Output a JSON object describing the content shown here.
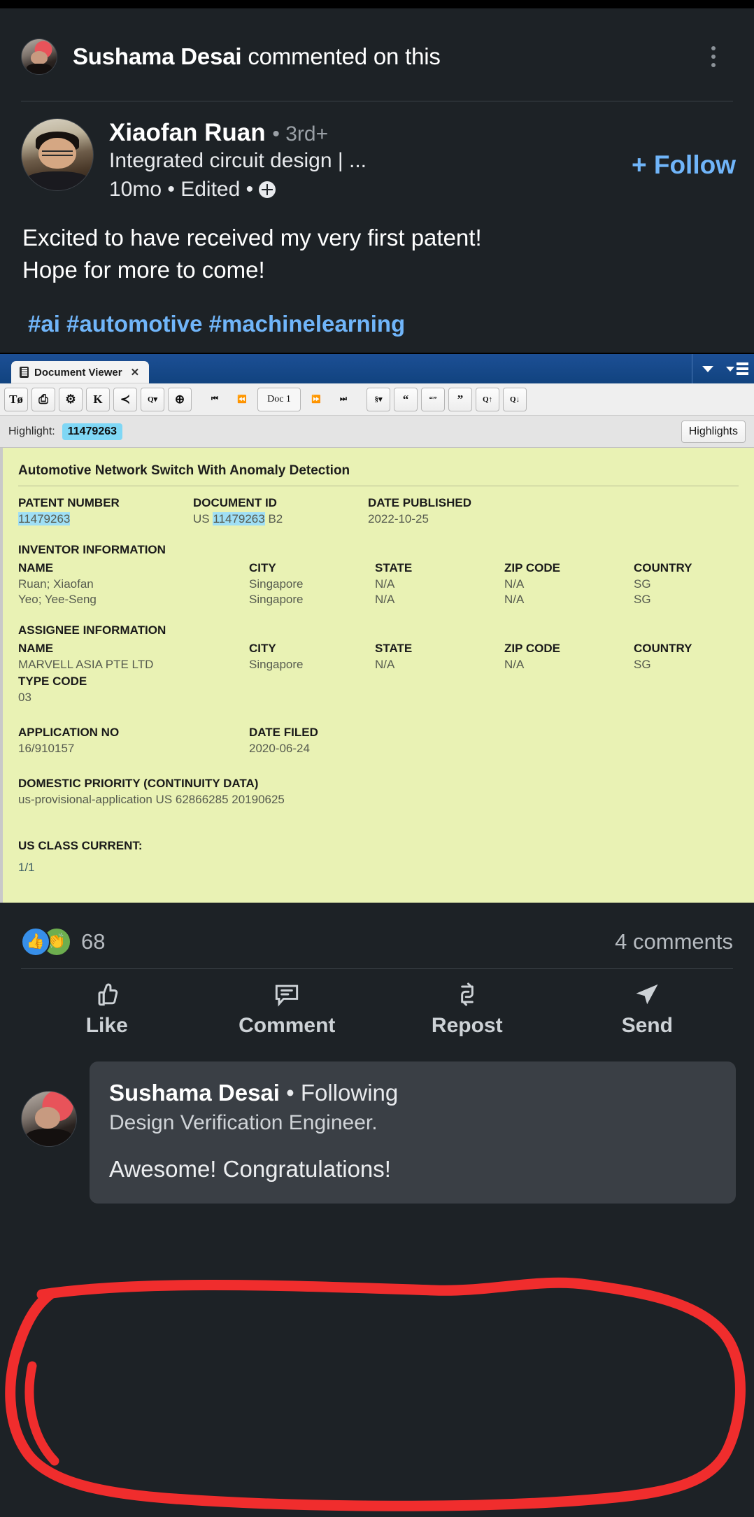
{
  "activity": {
    "actor": "Sushama Desai",
    "action": " commented on this",
    "menu_icon": "kebab-menu-icon"
  },
  "post": {
    "author_name": "Xiaofan Ruan",
    "author_degree": "• 3rd+",
    "headline": "Integrated circuit design | ...",
    "timestamp": "10mo • Edited •",
    "visibility_icon": "globe-icon",
    "follow_label": "+ Follow",
    "text_line1": "Excited to have received my very first patent!",
    "text_line2": "Hope for more to come!",
    "hashtags": "#ai #automotive #machinelearning"
  },
  "doc_viewer": {
    "tab_label": "Document Viewer",
    "tab_close": "✕",
    "toolbar": [
      {
        "name": "text-image-toggle-button",
        "glyph": "Tø"
      },
      {
        "name": "print-button",
        "glyph": "⎙"
      },
      {
        "name": "settings-gear-button",
        "glyph": "⚙"
      },
      {
        "name": "k-logo-button",
        "glyph": "K"
      },
      {
        "name": "share-button",
        "glyph": "≺"
      },
      {
        "name": "search-dropdown-button",
        "glyph": "Q▾"
      },
      {
        "name": "zoom-in-button",
        "glyph": "⊕"
      },
      {
        "name": "first-doc-button",
        "glyph": "⏮"
      },
      {
        "name": "prev-doc-button",
        "glyph": "⏪"
      },
      {
        "name": "doc-number-field",
        "glyph": "Doc 1"
      },
      {
        "name": "next-doc-button",
        "glyph": "⏩"
      },
      {
        "name": "last-doc-button",
        "glyph": "⏭"
      },
      {
        "name": "section-dropdown-button",
        "glyph": "§▾"
      },
      {
        "name": "quote-open-button",
        "glyph": "“"
      },
      {
        "name": "quote-both-button",
        "glyph": "“”"
      },
      {
        "name": "quote-close-button",
        "glyph": "”"
      },
      {
        "name": "search-prev-button",
        "glyph": "Q↑"
      },
      {
        "name": "search-next-button",
        "glyph": "Q↓"
      }
    ],
    "tabbar_dropdown_icon": "chevron-down-icon",
    "tabbar_list_icon": "list-menu-icon",
    "highlight_label": "Highlight:",
    "highlight_value": "11479263",
    "highlights_button": "Highlights"
  },
  "patent": {
    "title": "Automotive Network Switch With Anomaly Detection",
    "top_headers": [
      "PATENT NUMBER",
      "DOCUMENT ID",
      "DATE PUBLISHED"
    ],
    "patent_number": "11479263",
    "document_id_prefix": "US ",
    "document_id_mark": "11479263",
    "document_id_suffix": " B2",
    "date_published": "2022-10-25",
    "inventor_section": "INVENTOR INFORMATION",
    "person_headers": [
      "NAME",
      "CITY",
      "STATE",
      "ZIP CODE",
      "COUNTRY"
    ],
    "inventors": [
      [
        "Ruan; Xiaofan",
        "Singapore",
        "N/A",
        "N/A",
        "SG"
      ],
      [
        "Yeo; Yee-Seng",
        "Singapore",
        "N/A",
        "N/A",
        "SG"
      ]
    ],
    "assignee_section": "ASSIGNEE INFORMATION",
    "assignees": [
      [
        "MARVELL ASIA PTE LTD",
        "Singapore",
        "N/A",
        "N/A",
        "SG"
      ]
    ],
    "type_code_label": "TYPE CODE",
    "type_code_value": "03",
    "application_headers": [
      "APPLICATION NO",
      "DATE FILED"
    ],
    "application_no": "16/910157",
    "date_filed": "2020-06-24",
    "domestic_priority_label": "DOMESTIC PRIORITY (CONTINUITY DATA)",
    "domestic_priority_value": "us-provisional-application US 62866285 20190625",
    "us_class_label": "US CLASS CURRENT:",
    "us_class_value": "1/1"
  },
  "social": {
    "reaction_like_icon": "thumbs-up-icon",
    "reaction_clap_icon": "clap-icon",
    "reaction_count": "68",
    "comments_count": "4 comments",
    "actions": [
      {
        "icon": "thumbs-up-outline-icon",
        "label": "Like"
      },
      {
        "icon": "comment-bubble-icon",
        "label": "Comment"
      },
      {
        "icon": "repost-icon",
        "label": "Repost"
      },
      {
        "icon": "send-paper-plane-icon",
        "label": "Send"
      }
    ]
  },
  "comment": {
    "author": "Sushama Desai",
    "relationship": "• Following",
    "title": "Design Verification Engineer.",
    "text": "Awesome! Congratulations!"
  },
  "colors": {
    "background": "#1d2226",
    "accent_blue": "#70b5f9",
    "doc_tabbar_blue": "#11437f",
    "patent_page": "#e9f2b4",
    "highlight_cyan": "#9fdff5",
    "annotation_red": "#f02d2d",
    "bubble": "#3a3f45"
  }
}
